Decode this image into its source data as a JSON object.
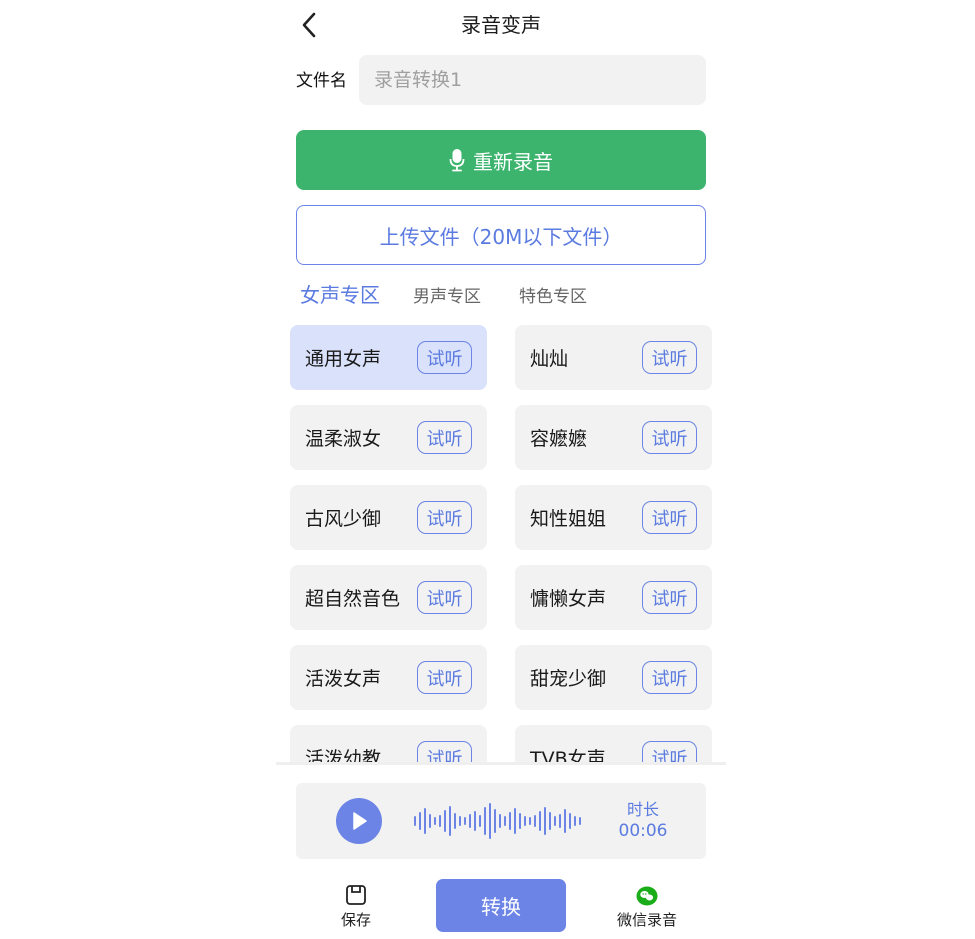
{
  "header": {
    "title": "录音变声"
  },
  "file": {
    "label": "文件名",
    "placeholder": "录音转换1",
    "value": ""
  },
  "actions": {
    "rerecord_label": "重新录音",
    "upload_label": "上传文件（20M以下文件）"
  },
  "tabs": [
    {
      "label": "女声专区",
      "active": true
    },
    {
      "label": "男声专区",
      "active": false
    },
    {
      "label": "特色专区",
      "active": false
    }
  ],
  "voices": [
    {
      "name": "通用女声",
      "selected": true
    },
    {
      "name": "灿灿",
      "selected": false
    },
    {
      "name": "温柔淑女",
      "selected": false
    },
    {
      "name": "容嬷嬷",
      "selected": false
    },
    {
      "name": "古风少御",
      "selected": false
    },
    {
      "name": "知性姐姐",
      "selected": false
    },
    {
      "name": "超自然音色",
      "selected": false
    },
    {
      "name": "慵懒女声",
      "selected": false
    },
    {
      "name": "活泼女声",
      "selected": false
    },
    {
      "name": "甜宠少御",
      "selected": false
    },
    {
      "name": "活泼幼教",
      "selected": false
    },
    {
      "name": "TVB女声",
      "selected": false
    }
  ],
  "try_label": "试听",
  "player": {
    "duration_label": "时长",
    "duration_value": "00:06"
  },
  "bottom": {
    "save_label": "保存",
    "convert_label": "转换",
    "wechat_label": "微信录音"
  },
  "colors": {
    "accent": "#6b84e6",
    "green": "#3cb46e",
    "wechat": "#1aad19",
    "selected_bg": "#d9e1fb",
    "card_bg": "#f2f2f2"
  },
  "icons": {
    "back": "chevron-left-icon",
    "mic": "microphone-icon",
    "play": "play-icon",
    "save": "save-icon",
    "wechat": "wechat-icon"
  }
}
